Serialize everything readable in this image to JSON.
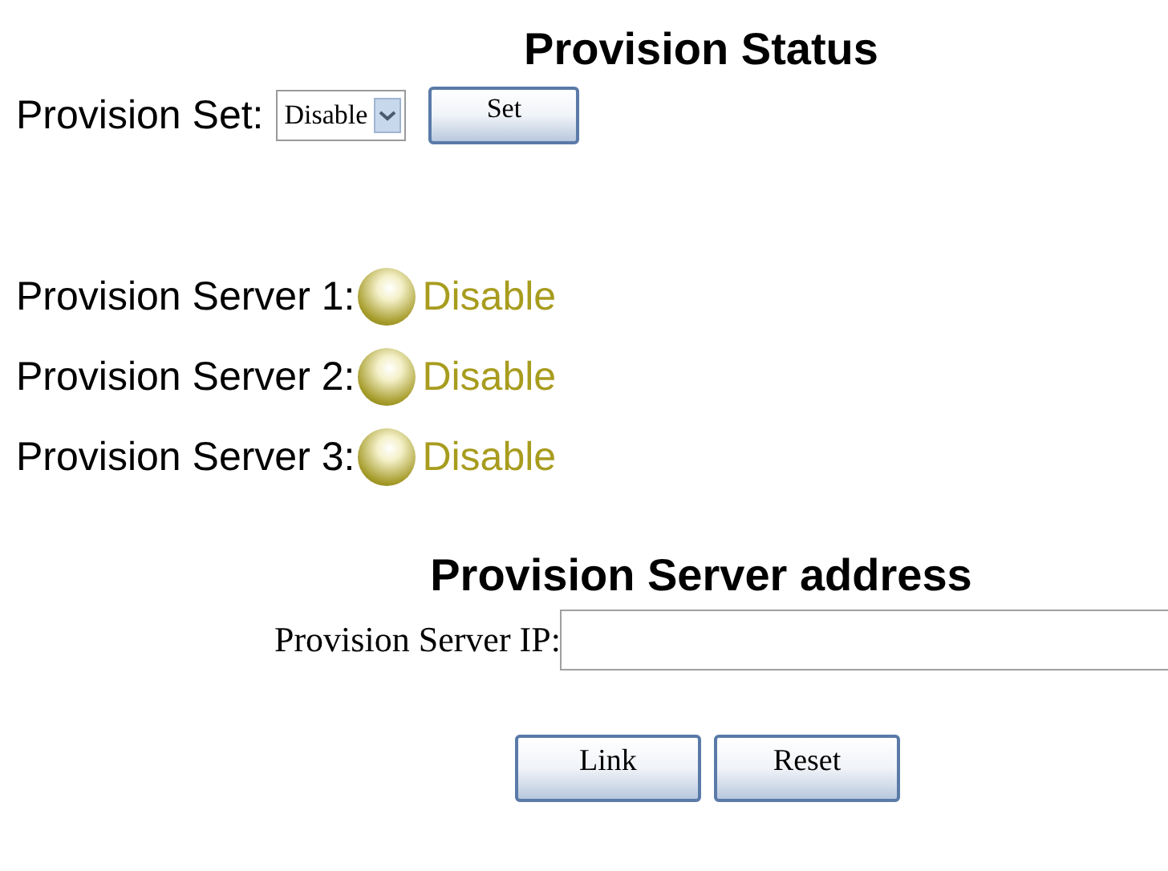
{
  "status_section": {
    "title": "Provision Status",
    "set_label": "Provision Set:",
    "set_select": {
      "value": "Disable"
    },
    "set_button": "Set"
  },
  "servers": [
    {
      "label": "Provision Server 1:",
      "on": false,
      "status": "Disable"
    },
    {
      "label": "Provision Server 2:",
      "on": false,
      "status": "Disable"
    },
    {
      "label": "Provision Server 3:",
      "on": false,
      "status": "Disable"
    }
  ],
  "address_section": {
    "title": "Provision Server address",
    "ip_label": "Provision Server IP:"
  },
  "buttons": [
    "Link",
    "Reset"
  ]
}
